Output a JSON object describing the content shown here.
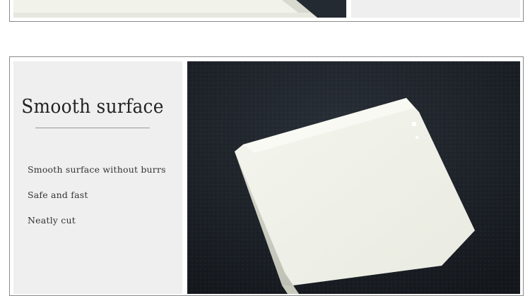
{
  "section": {
    "title": "Smooth surface",
    "features": [
      "Smooth surface without burrs",
      "Safe and fast",
      "Neatly cut"
    ]
  },
  "images": {
    "top_photo": "white-silicone-sheet-photo",
    "main_photo": "white-silicone-sheet-on-black-leather-photo"
  },
  "colors": {
    "panel_bg": "#efefef",
    "frame_border": "#8a8a8a",
    "photo_bg": "#1b2026",
    "sheet": "#f2f3ea"
  }
}
